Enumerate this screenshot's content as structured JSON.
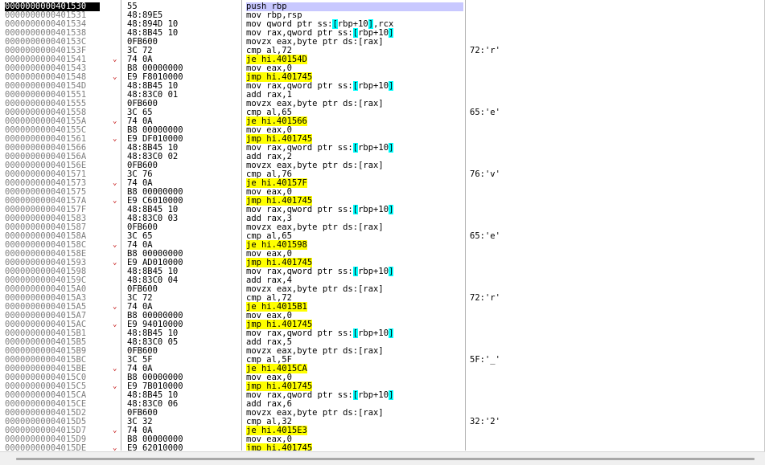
{
  "colors": {
    "address": "#808080",
    "current_address_bg": "#000000",
    "jump_highlight": "#ffff00",
    "register_highlight": "#00ffff",
    "arrow": "#c00000"
  },
  "rows": [
    {
      "addr": "0000000000401530",
      "arrow": "",
      "bytes": "55",
      "instr": [
        {
          "t": "push rbp"
        }
      ],
      "comment": "",
      "current": true
    },
    {
      "addr": "0000000000401531",
      "arrow": "",
      "bytes": "48:89E5",
      "instr": [
        {
          "t": "mov rbp,rsp"
        }
      ],
      "comment": ""
    },
    {
      "addr": "0000000000401534",
      "arrow": "",
      "bytes": "48:894D 10",
      "instr": [
        {
          "t": "mov qword ptr ss:"
        },
        {
          "t": "[",
          "h": "reg"
        },
        {
          "t": "rbp+10"
        },
        {
          "t": "]",
          "h": "reg"
        },
        {
          "t": ",rcx"
        }
      ],
      "comment": ""
    },
    {
      "addr": "0000000000401538",
      "arrow": "",
      "bytes": "48:8B45 10",
      "instr": [
        {
          "t": "mov rax,qword ptr ss:"
        },
        {
          "t": "[",
          "h": "reg"
        },
        {
          "t": "rbp+10"
        },
        {
          "t": "]",
          "h": "reg"
        }
      ],
      "comment": ""
    },
    {
      "addr": "000000000040153C",
      "arrow": "",
      "bytes": "0FB600",
      "instr": [
        {
          "t": "movzx eax,byte ptr ds:[rax]"
        }
      ],
      "comment": ""
    },
    {
      "addr": "000000000040153F",
      "arrow": "",
      "bytes": "3C 72",
      "instr": [
        {
          "t": "cmp al,72"
        }
      ],
      "comment": "72:'r'"
    },
    {
      "addr": "0000000000401541",
      "arrow": "⌄",
      "bytes": "74 0A",
      "instr": [
        {
          "t": "je hi.40154D",
          "h": "jmp"
        }
      ],
      "comment": ""
    },
    {
      "addr": "0000000000401543",
      "arrow": "",
      "bytes": "B8 00000000",
      "instr": [
        {
          "t": "mov eax,0"
        }
      ],
      "comment": ""
    },
    {
      "addr": "0000000000401548",
      "arrow": "⌄",
      "bytes": "E9 F8010000",
      "instr": [
        {
          "t": "jmp hi.401745",
          "h": "jmp"
        }
      ],
      "comment": ""
    },
    {
      "addr": "000000000040154D",
      "arrow": "",
      "bytes": "48:8B45 10",
      "instr": [
        {
          "t": "mov rax,qword ptr ss:"
        },
        {
          "t": "[",
          "h": "reg"
        },
        {
          "t": "rbp+10"
        },
        {
          "t": "]",
          "h": "reg"
        }
      ],
      "comment": ""
    },
    {
      "addr": "0000000000401551",
      "arrow": "",
      "bytes": "48:83C0 01",
      "instr": [
        {
          "t": "add rax,1"
        }
      ],
      "comment": ""
    },
    {
      "addr": "0000000000401555",
      "arrow": "",
      "bytes": "0FB600",
      "instr": [
        {
          "t": "movzx eax,byte ptr ds:[rax]"
        }
      ],
      "comment": ""
    },
    {
      "addr": "0000000000401558",
      "arrow": "",
      "bytes": "3C 65",
      "instr": [
        {
          "t": "cmp al,65"
        }
      ],
      "comment": "65:'e'"
    },
    {
      "addr": "000000000040155A",
      "arrow": "⌄",
      "bytes": "74 0A",
      "instr": [
        {
          "t": "je hi.401566",
          "h": "jmp"
        }
      ],
      "comment": ""
    },
    {
      "addr": "000000000040155C",
      "arrow": "",
      "bytes": "B8 00000000",
      "instr": [
        {
          "t": "mov eax,0"
        }
      ],
      "comment": ""
    },
    {
      "addr": "0000000000401561",
      "arrow": "⌄",
      "bytes": "E9 DF010000",
      "instr": [
        {
          "t": "jmp hi.401745",
          "h": "jmp"
        }
      ],
      "comment": ""
    },
    {
      "addr": "0000000000401566",
      "arrow": "",
      "bytes": "48:8B45 10",
      "instr": [
        {
          "t": "mov rax,qword ptr ss:"
        },
        {
          "t": "[",
          "h": "reg"
        },
        {
          "t": "rbp+10"
        },
        {
          "t": "]",
          "h": "reg"
        }
      ],
      "comment": ""
    },
    {
      "addr": "000000000040156A",
      "arrow": "",
      "bytes": "48:83C0 02",
      "instr": [
        {
          "t": "add rax,2"
        }
      ],
      "comment": ""
    },
    {
      "addr": "000000000040156E",
      "arrow": "",
      "bytes": "0FB600",
      "instr": [
        {
          "t": "movzx eax,byte ptr ds:[rax]"
        }
      ],
      "comment": ""
    },
    {
      "addr": "0000000000401571",
      "arrow": "",
      "bytes": "3C 76",
      "instr": [
        {
          "t": "cmp al,76"
        }
      ],
      "comment": "76:'v'"
    },
    {
      "addr": "0000000000401573",
      "arrow": "⌄",
      "bytes": "74 0A",
      "instr": [
        {
          "t": "je hi.40157F",
          "h": "jmp"
        }
      ],
      "comment": ""
    },
    {
      "addr": "0000000000401575",
      "arrow": "",
      "bytes": "B8 00000000",
      "instr": [
        {
          "t": "mov eax,0"
        }
      ],
      "comment": ""
    },
    {
      "addr": "000000000040157A",
      "arrow": "⌄",
      "bytes": "E9 C6010000",
      "instr": [
        {
          "t": "jmp hi.401745",
          "h": "jmp"
        }
      ],
      "comment": ""
    },
    {
      "addr": "000000000040157F",
      "arrow": "",
      "bytes": "48:8B45 10",
      "instr": [
        {
          "t": "mov rax,qword ptr ss:"
        },
        {
          "t": "[",
          "h": "reg"
        },
        {
          "t": "rbp+10"
        },
        {
          "t": "]",
          "h": "reg"
        }
      ],
      "comment": ""
    },
    {
      "addr": "0000000000401583",
      "arrow": "",
      "bytes": "48:83C0 03",
      "instr": [
        {
          "t": "add rax,3"
        }
      ],
      "comment": ""
    },
    {
      "addr": "0000000000401587",
      "arrow": "",
      "bytes": "0FB600",
      "instr": [
        {
          "t": "movzx eax,byte ptr ds:[rax]"
        }
      ],
      "comment": ""
    },
    {
      "addr": "000000000040158A",
      "arrow": "",
      "bytes": "3C 65",
      "instr": [
        {
          "t": "cmp al,65"
        }
      ],
      "comment": "65:'e'"
    },
    {
      "addr": "000000000040158C",
      "arrow": "⌄",
      "bytes": "74 0A",
      "instr": [
        {
          "t": "je hi.401598",
          "h": "jmp"
        }
      ],
      "comment": ""
    },
    {
      "addr": "000000000040158E",
      "arrow": "",
      "bytes": "B8 00000000",
      "instr": [
        {
          "t": "mov eax,0"
        }
      ],
      "comment": ""
    },
    {
      "addr": "0000000000401593",
      "arrow": "⌄",
      "bytes": "E9 AD010000",
      "instr": [
        {
          "t": "jmp hi.401745",
          "h": "jmp"
        }
      ],
      "comment": ""
    },
    {
      "addr": "0000000000401598",
      "arrow": "",
      "bytes": "48:8B45 10",
      "instr": [
        {
          "t": "mov rax,qword ptr ss:"
        },
        {
          "t": "[",
          "h": "reg"
        },
        {
          "t": "rbp+10"
        },
        {
          "t": "]",
          "h": "reg"
        }
      ],
      "comment": ""
    },
    {
      "addr": "000000000040159C",
      "arrow": "",
      "bytes": "48:83C0 04",
      "instr": [
        {
          "t": "add rax,4"
        }
      ],
      "comment": ""
    },
    {
      "addr": "00000000004015A0",
      "arrow": "",
      "bytes": "0FB600",
      "instr": [
        {
          "t": "movzx eax,byte ptr ds:[rax]"
        }
      ],
      "comment": ""
    },
    {
      "addr": "00000000004015A3",
      "arrow": "",
      "bytes": "3C 72",
      "instr": [
        {
          "t": "cmp al,72"
        }
      ],
      "comment": "72:'r'"
    },
    {
      "addr": "00000000004015A5",
      "arrow": "⌄",
      "bytes": "74 0A",
      "instr": [
        {
          "t": "je hi.4015B1",
          "h": "jmp"
        }
      ],
      "comment": ""
    },
    {
      "addr": "00000000004015A7",
      "arrow": "",
      "bytes": "B8 00000000",
      "instr": [
        {
          "t": "mov eax,0"
        }
      ],
      "comment": ""
    },
    {
      "addr": "00000000004015AC",
      "arrow": "⌄",
      "bytes": "E9 94010000",
      "instr": [
        {
          "t": "jmp hi.401745",
          "h": "jmp"
        }
      ],
      "comment": ""
    },
    {
      "addr": "00000000004015B1",
      "arrow": "",
      "bytes": "48:8B45 10",
      "instr": [
        {
          "t": "mov rax,qword ptr ss:"
        },
        {
          "t": "[",
          "h": "reg"
        },
        {
          "t": "rbp+10"
        },
        {
          "t": "]",
          "h": "reg"
        }
      ],
      "comment": ""
    },
    {
      "addr": "00000000004015B5",
      "arrow": "",
      "bytes": "48:83C0 05",
      "instr": [
        {
          "t": "add rax,5"
        }
      ],
      "comment": ""
    },
    {
      "addr": "00000000004015B9",
      "arrow": "",
      "bytes": "0FB600",
      "instr": [
        {
          "t": "movzx eax,byte ptr ds:[rax]"
        }
      ],
      "comment": ""
    },
    {
      "addr": "00000000004015BC",
      "arrow": "",
      "bytes": "3C 5F",
      "instr": [
        {
          "t": "cmp al,5F"
        }
      ],
      "comment": "5F:'_'"
    },
    {
      "addr": "00000000004015BE",
      "arrow": "⌄",
      "bytes": "74 0A",
      "instr": [
        {
          "t": "je hi.4015CA",
          "h": "jmp"
        }
      ],
      "comment": ""
    },
    {
      "addr": "00000000004015C0",
      "arrow": "",
      "bytes": "B8 00000000",
      "instr": [
        {
          "t": "mov eax,0"
        }
      ],
      "comment": ""
    },
    {
      "addr": "00000000004015C5",
      "arrow": "⌄",
      "bytes": "E9 7B010000",
      "instr": [
        {
          "t": "jmp hi.401745",
          "h": "jmp"
        }
      ],
      "comment": ""
    },
    {
      "addr": "00000000004015CA",
      "arrow": "",
      "bytes": "48:8B45 10",
      "instr": [
        {
          "t": "mov rax,qword ptr ss:"
        },
        {
          "t": "[",
          "h": "reg"
        },
        {
          "t": "rbp+10"
        },
        {
          "t": "]",
          "h": "reg"
        }
      ],
      "comment": ""
    },
    {
      "addr": "00000000004015CE",
      "arrow": "",
      "bytes": "48:83C0 06",
      "instr": [
        {
          "t": "add rax,6"
        }
      ],
      "comment": ""
    },
    {
      "addr": "00000000004015D2",
      "arrow": "",
      "bytes": "0FB600",
      "instr": [
        {
          "t": "movzx eax,byte ptr ds:[rax]"
        }
      ],
      "comment": ""
    },
    {
      "addr": "00000000004015D5",
      "arrow": "",
      "bytes": "3C 32",
      "instr": [
        {
          "t": "cmp al,32"
        }
      ],
      "comment": "32:'2'"
    },
    {
      "addr": "00000000004015D7",
      "arrow": "⌄",
      "bytes": "74 0A",
      "instr": [
        {
          "t": "je hi.4015E3",
          "h": "jmp"
        }
      ],
      "comment": ""
    },
    {
      "addr": "00000000004015D9",
      "arrow": "",
      "bytes": "B8 00000000",
      "instr": [
        {
          "t": "mov eax,0"
        }
      ],
      "comment": ""
    },
    {
      "addr": "00000000004015DE",
      "arrow": "⌄",
      "bytes": "E9 62010000",
      "instr": [
        {
          "t": "jmp hi.401745",
          "h": "jmp"
        }
      ],
      "comment": ""
    }
  ]
}
